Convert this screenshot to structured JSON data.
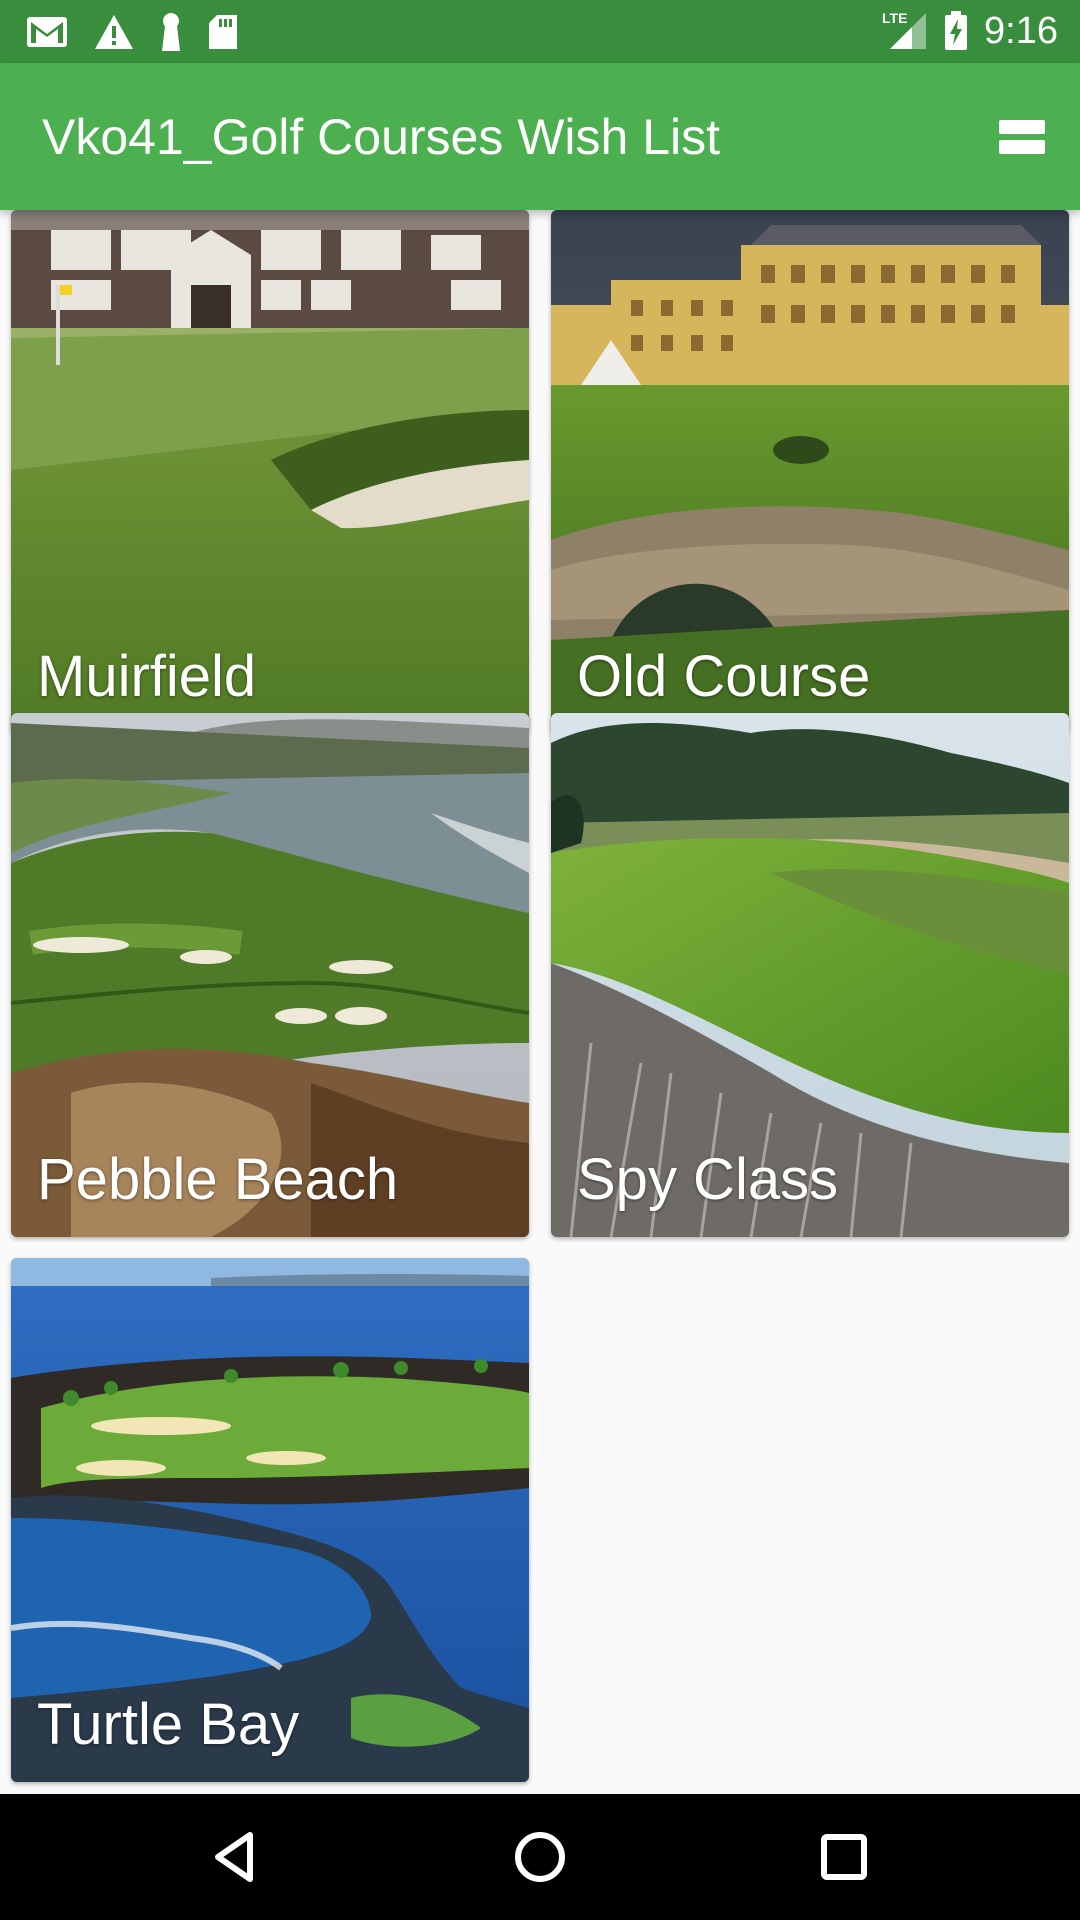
{
  "status_bar": {
    "time": "9:16",
    "left_icons": [
      "gmail-icon",
      "warning-icon",
      "keyhole-icon",
      "sd-card-icon"
    ],
    "right_icons": [
      "lte-signal-icon",
      "battery-charging-icon"
    ],
    "network_label": "LTE"
  },
  "app_bar": {
    "title": "Vko41_Golf Courses Wish List",
    "action_icon": "view-stream-icon",
    "color": "#4caf50",
    "status_color": "#388e3c"
  },
  "courses": [
    {
      "name": "Muirfield",
      "scene": "clubhouse-bunker"
    },
    {
      "name": "Old Course",
      "scene": "hotel-stone-bridge"
    },
    {
      "name": "Pebble Beach",
      "scene": "coastal-cliff-green"
    },
    {
      "name": "Spy Class",
      "scene": "dune-fairway"
    },
    {
      "name": "Turtle Bay",
      "scene": "ocean-lava-course"
    }
  ],
  "nav_bar": {
    "buttons": [
      "back-icon",
      "home-icon",
      "recents-icon"
    ]
  }
}
